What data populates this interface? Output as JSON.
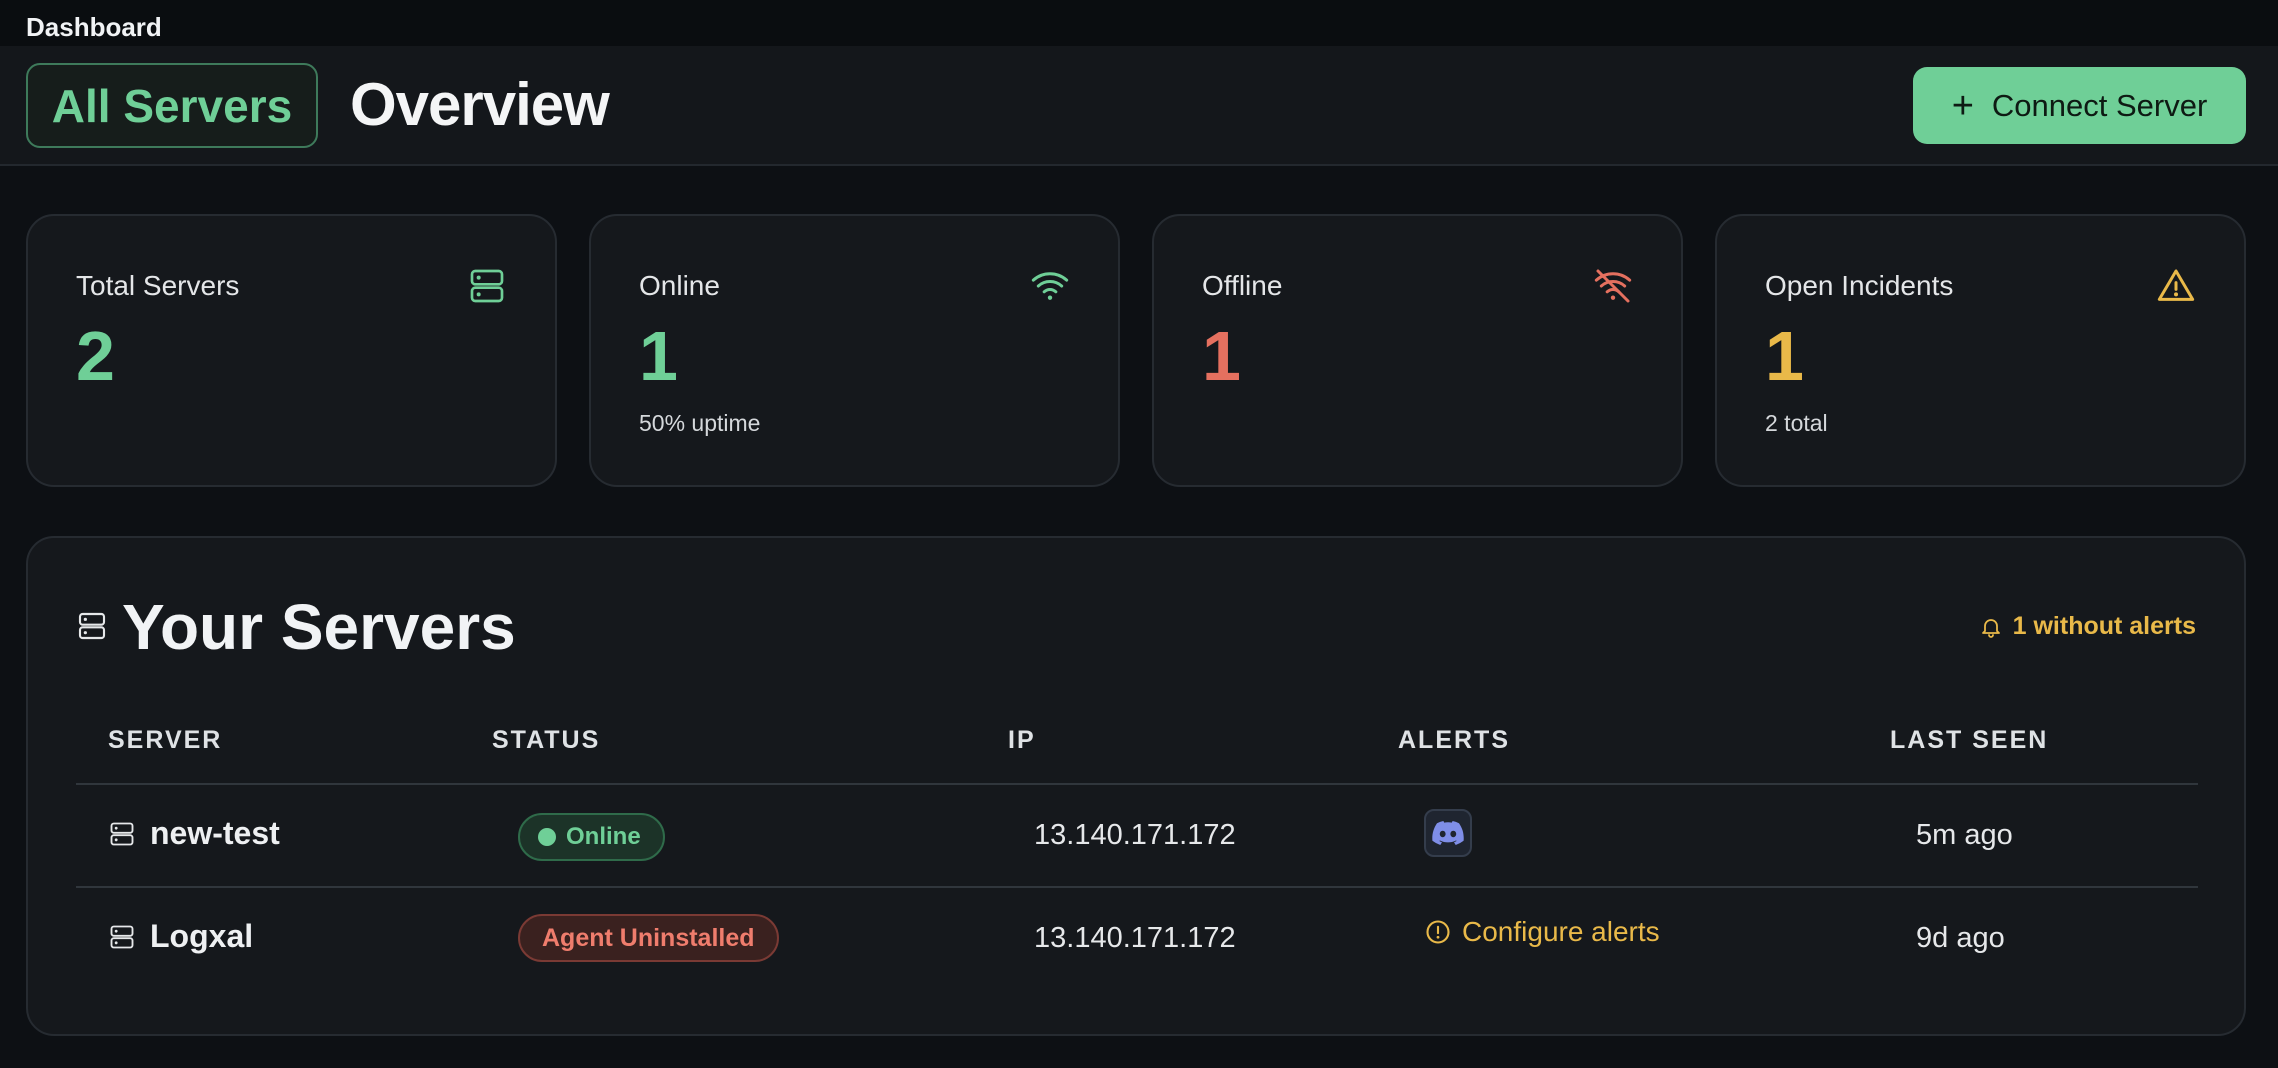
{
  "app": {
    "title": "Dashboard"
  },
  "header": {
    "tab_label": "All Servers",
    "page_title": "Overview",
    "connect_label": "Connect Server"
  },
  "stats": [
    {
      "label": "Total Servers",
      "value": "2",
      "sub": "",
      "icon": "server-icon",
      "color": "#6fcf97"
    },
    {
      "label": "Online",
      "value": "1",
      "sub": "50% uptime",
      "icon": "wifi-icon",
      "color": "#6fcf97"
    },
    {
      "label": "Offline",
      "value": "1",
      "sub": "",
      "icon": "wifi-off-icon",
      "color": "#e5705f"
    },
    {
      "label": "Open Incidents",
      "value": "1",
      "sub": "2 total",
      "icon": "warning-icon",
      "color": "#e9b949"
    }
  ],
  "servers_panel": {
    "title": "Your Servers",
    "alert_note": "1 without alerts",
    "columns": [
      "SERVER",
      "STATUS",
      "IP",
      "ALERTS",
      "LAST SEEN"
    ],
    "rows": [
      {
        "name": "new-test",
        "status": "Online",
        "ip": "13.140.171.172",
        "alert": "discord-icon",
        "last_seen": "5m ago"
      },
      {
        "name": "Logxal",
        "status": "Agent Uninstalled",
        "ip": "13.140.171.172",
        "alert_text": "Configure alerts",
        "last_seen": "9d ago"
      }
    ]
  },
  "colors": {
    "accent_green": "#6fcf97",
    "danger_red": "#e5705f",
    "warning_amber": "#e9b949",
    "background": "#0d1014",
    "surface": "#15181c"
  }
}
